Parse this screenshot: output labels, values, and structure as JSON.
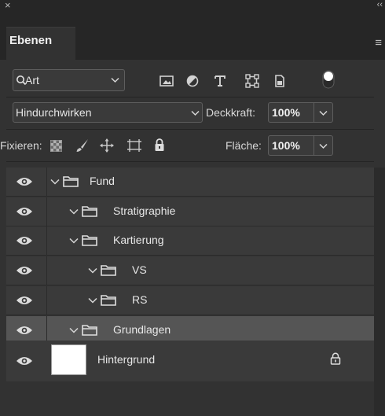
{
  "header": {
    "close_glyph": "×",
    "collapse_glyph": "‹‹",
    "menu_glyph": "≡"
  },
  "tabs": [
    {
      "label": "Ebenen",
      "active": true
    }
  ],
  "filter": {
    "search_glyph": "Q",
    "kind_label": "Art",
    "chevron": "⌄",
    "icons": [
      "image-filter-icon",
      "adjustment-filter-icon",
      "type-filter-icon",
      "shape-filter-icon",
      "smartobject-filter-icon"
    ]
  },
  "blend": {
    "mode": "Hindurchwirken",
    "opacity_label": "Deckkraft:",
    "opacity_value": "100%"
  },
  "lock": {
    "label": "Fixieren:",
    "fill_label": "Fläche:",
    "fill_value": "100%"
  },
  "layers": [
    {
      "name": "Fund",
      "indent": 0,
      "type": "group",
      "expanded": true,
      "visible": true
    },
    {
      "name": "Stratigraphie",
      "indent": 1,
      "type": "group",
      "expanded": true,
      "visible": true
    },
    {
      "name": "Kartierung",
      "indent": 1,
      "type": "group",
      "expanded": true,
      "visible": true
    },
    {
      "name": "VS",
      "indent": 2,
      "type": "group",
      "expanded": true,
      "visible": true
    },
    {
      "name": "RS",
      "indent": 2,
      "type": "group",
      "expanded": true,
      "visible": true
    },
    {
      "name": "Grundlagen",
      "indent": 1,
      "type": "group",
      "expanded": true,
      "visible": true,
      "selected": true
    }
  ],
  "background_layer": {
    "name": "Hintergrund",
    "locked": true,
    "visible": true
  },
  "colors": {
    "panel": "#323232",
    "row": "#3a3a3a",
    "selected_row": "#555555",
    "topbar": "#262626"
  }
}
